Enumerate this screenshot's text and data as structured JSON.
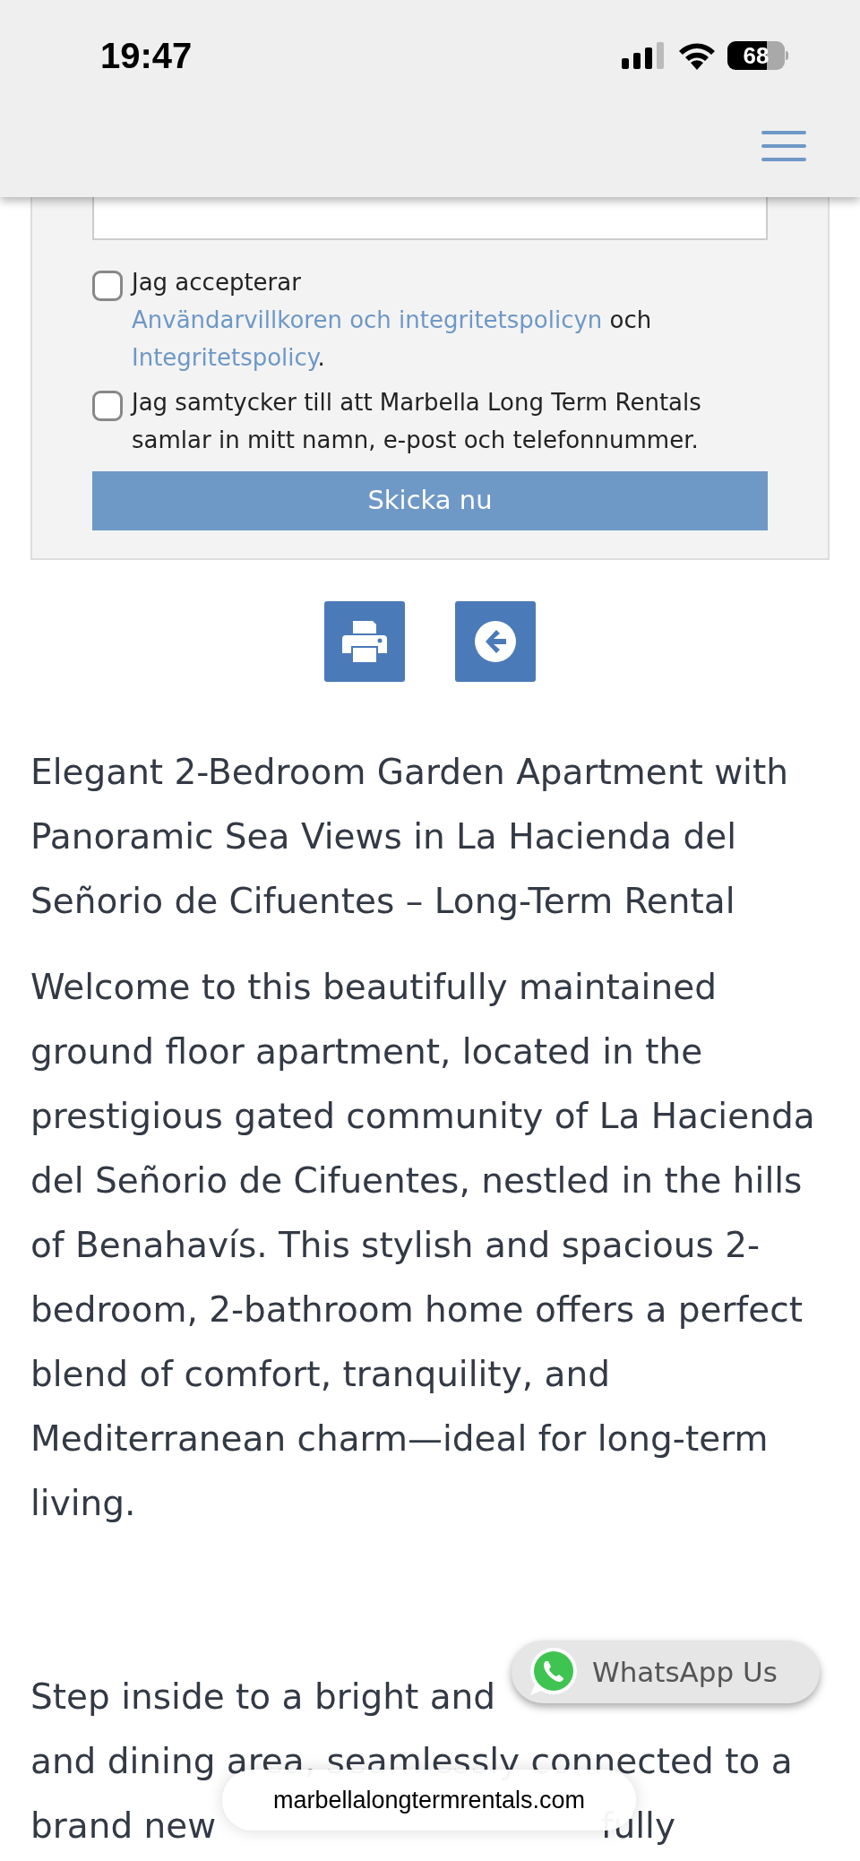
{
  "status_bar": {
    "time": "19:47",
    "battery": "68"
  },
  "consents": [
    {
      "checked": false,
      "parts": [
        {
          "text": "Jag accepterar ",
          "kind": "text"
        },
        {
          "text": "Användarvillkoren och integritetspolicyn",
          "kind": "link"
        },
        {
          "text": " och ",
          "kind": "text"
        },
        {
          "text": "Integritetspolicy",
          "kind": "link"
        },
        {
          "text": ".",
          "kind": "text"
        }
      ]
    },
    {
      "checked": false,
      "parts": [
        {
          "text": "Jag samtycker till att Marbella Long Term Rentals samlar in mitt namn, e-post och telefonnummer.",
          "kind": "text"
        }
      ]
    }
  ],
  "submit_button": "Skicka nu",
  "actions": [
    {
      "kind": "print"
    },
    {
      "kind": "back"
    }
  ],
  "title": "Elegant 2-Bedroom Garden Apartment with Panoramic Sea Views in La Hacienda del Señorio de Cifuentes – Long-Term Rental",
  "paragraph": "Welcome to this beautifully maintained ground floor apartment, located in the prestigious gated community of La Hacienda del Señorio de Cifuentes, nestled in the hills of Benahavís. This stylish and spacious 2-bedroom, 2-bathroom home offers a perfect blend of comfort, tranquility, and Mediterranean charm—ideal for long-term living.",
  "partly_covered_lines": [
    [
      "Step inside to a bright and"
    ],
    [
      "and dining area, seamlessly connected to a"
    ],
    [
      "brand new",
      "fully"
    ]
  ],
  "whatsapp_button": "WhatsApp Us",
  "url_bar": "marbellalongtermrentals.com"
}
